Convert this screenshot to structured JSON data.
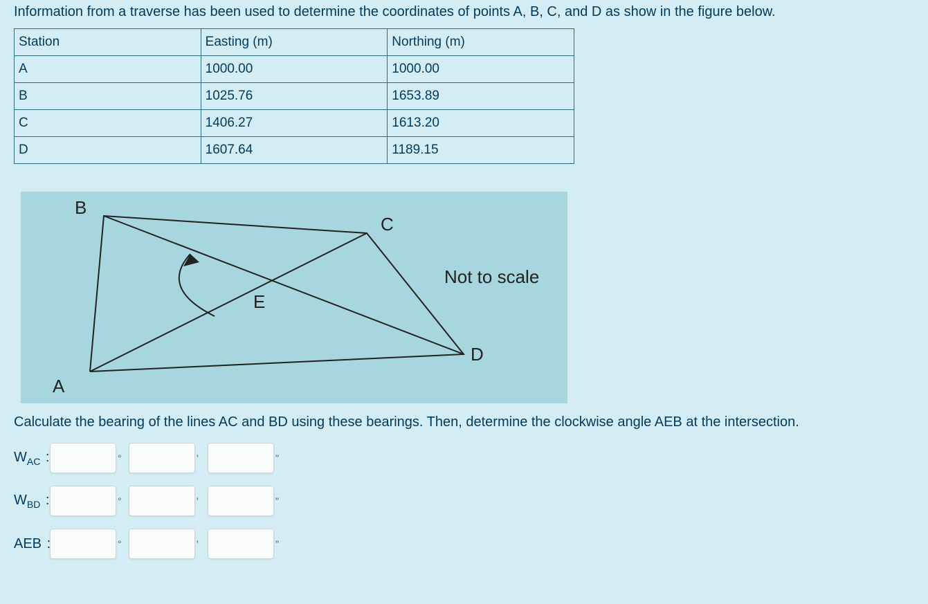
{
  "intro": "Information from a traverse has been used to determine the coordinates of points A, B, C, and D as show in the figure below.",
  "table": {
    "headers": {
      "station": "Station",
      "easting": "Easting (m)",
      "northing": "Northing (m)"
    },
    "rows": [
      {
        "station": "A",
        "easting": "1000.00",
        "northing": "1000.00"
      },
      {
        "station": "B",
        "easting": "1025.76",
        "northing": "1653.89"
      },
      {
        "station": "C",
        "easting": "1406.27",
        "northing": "1613.20"
      },
      {
        "station": "D",
        "easting": "1607.64",
        "northing": "1189.15"
      }
    ]
  },
  "figure": {
    "labels": {
      "A": "A",
      "B": "B",
      "C": "C",
      "D": "D",
      "E": "E"
    },
    "note": "Not to scale"
  },
  "question": "Calculate the bearing of the lines AC and BD using these bearings. Then, determine the clockwise angle AEB at the intersection.",
  "answers": {
    "wac": {
      "prefix": "W",
      "sub": "AC",
      "deg": "",
      "min": "",
      "sec": ""
    },
    "wbd": {
      "prefix": "W",
      "sub": "BD",
      "deg": "",
      "min": "",
      "sec": ""
    },
    "aeb": {
      "prefix": "AEB",
      "sub": "",
      "deg": "",
      "min": "",
      "sec": ""
    }
  },
  "units": {
    "deg": "°",
    "min": "'",
    "sec": "\""
  }
}
